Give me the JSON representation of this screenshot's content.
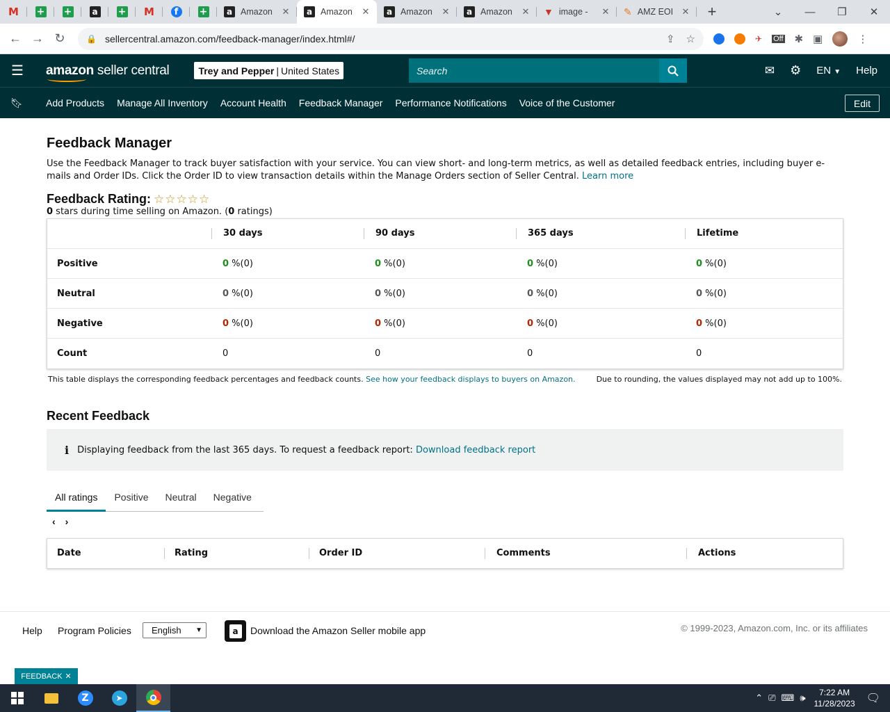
{
  "browser": {
    "tabs": [
      {
        "title": "Amazon",
        "icon": "amazon-icon",
        "active": false
      },
      {
        "title": "Amazon",
        "icon": "amazon-icon",
        "active": true
      },
      {
        "title": "Amazon",
        "icon": "amazon-icon",
        "active": false
      },
      {
        "title": "Amazon",
        "icon": "amazon-icon",
        "active": false
      },
      {
        "title": "image - ",
        "icon": "image-app-icon",
        "active": false
      },
      {
        "title": "AMZ EOI",
        "icon": "amz-eoi-icon",
        "active": false
      }
    ],
    "url": "sellercentral.amazon.com/feedback-manager/index.html#/"
  },
  "header": {
    "logo_amazon": "amazon",
    "logo_rest": " seller central",
    "store_name": "Trey and Pepper",
    "store_sep": "|",
    "store_region": "United States",
    "search_placeholder": "Search",
    "lang": "EN",
    "help": "Help"
  },
  "nav": {
    "items": [
      "Add Products",
      "Manage All Inventory",
      "Account Health",
      "Feedback Manager",
      "Performance Notifications",
      "Voice of the Customer"
    ],
    "edit": "Edit"
  },
  "page": {
    "title": "Feedback Manager",
    "intro": "Use the Feedback Manager to track buyer satisfaction with your service. You can view short- and long-term metrics, as well as detailed feedback entries, including buyer e-mails and Order IDs. Click the Order ID to view transaction details within the Manage Orders section of Seller Central.",
    "learn_more": "Learn more",
    "rating_label": "Feedback Rating:",
    "stars_count": "0",
    "stars_text": " stars during time selling on Amazon. (",
    "ratings_count": "0",
    "ratings_text": " ratings)"
  },
  "feedback_table": {
    "columns": [
      "30 days",
      "90 days",
      "365 days",
      "Lifetime"
    ],
    "rows": [
      {
        "label": "Positive",
        "cells": [
          {
            "n": "0",
            "t": " %(0)"
          },
          {
            "n": "0",
            "t": " %(0)"
          },
          {
            "n": "0",
            "t": " %(0)"
          },
          {
            "n": "0",
            "t": " %(0)"
          }
        ]
      },
      {
        "label": "Neutral",
        "cells": [
          {
            "n": "0",
            "t": " %(0)"
          },
          {
            "n": "0",
            "t": " %(0)"
          },
          {
            "n": "0",
            "t": " %(0)"
          },
          {
            "n": "0",
            "t": " %(0)"
          }
        ]
      },
      {
        "label": "Negative",
        "cells": [
          {
            "n": "0",
            "t": " %(0)"
          },
          {
            "n": "0",
            "t": " %(0)"
          },
          {
            "n": "0",
            "t": " %(0)"
          },
          {
            "n": "0",
            "t": " %(0)"
          }
        ]
      },
      {
        "label": "Count",
        "cells": [
          {
            "n": "",
            "t": "0"
          },
          {
            "n": "",
            "t": "0"
          },
          {
            "n": "",
            "t": "0"
          },
          {
            "n": "",
            "t": "0"
          }
        ]
      }
    ],
    "note": "This table displays the corresponding feedback percentages and feedback counts.",
    "note_link": "See how your feedback displays to buyers on Amazon.",
    "rounding_note": "Due to rounding, the values displayed may not add up to 100%."
  },
  "recent": {
    "title": "Recent Feedback",
    "info_text": "Displaying feedback from the last 365 days. To request a feedback report:",
    "info_link": "Download feedback report",
    "tabs": [
      "All ratings",
      "Positive",
      "Neutral",
      "Negative"
    ],
    "columns": [
      "Date",
      "Rating",
      "Order ID",
      "Comments",
      "Actions"
    ]
  },
  "footer": {
    "help": "Help",
    "policies": "Program Policies",
    "language": "English",
    "app_text": "Download the Amazon Seller mobile app",
    "copyright": "© 1999-2023, Amazon.com, Inc. or its affiliates",
    "feedback_btn": "FEEDBACK"
  },
  "taskbar": {
    "time": "7:22 AM",
    "date": "11/28/2023"
  },
  "colors": {
    "header_bg": "#002f36",
    "search_bg": "#00707a",
    "accent": "#008296",
    "positive": "#1e8e1e",
    "negative": "#b12704",
    "star": "#c7951f"
  }
}
